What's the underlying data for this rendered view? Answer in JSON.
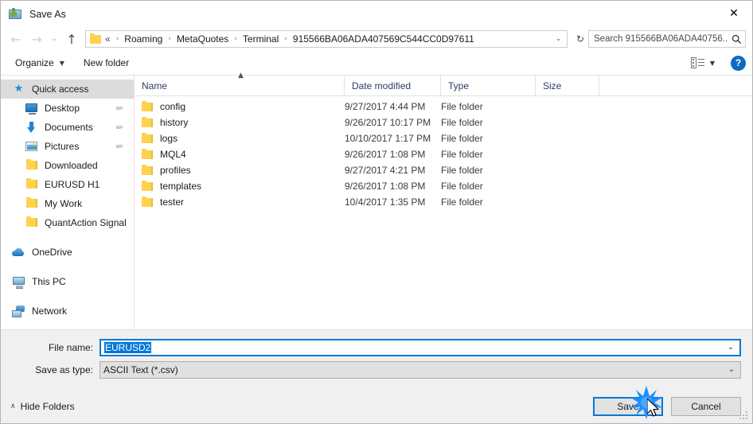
{
  "window": {
    "title": "Save As",
    "icon": "save-as-icon",
    "close_label": "✕"
  },
  "address_bar": {
    "back_icon": "←",
    "forward_icon": "→",
    "recent_icon": "⌄",
    "up_icon": "↑",
    "folder_icon": "folder-icon",
    "lead": "«",
    "crumbs": [
      "Roaming",
      "MetaQuotes",
      "Terminal",
      "915566BA06ADA407569C544CC0D97611"
    ],
    "separator": "›",
    "dropdown_icon": "⌄",
    "refresh_icon": "↻"
  },
  "search": {
    "placeholder": "Search 915566BA06ADA40756...",
    "icon": "⚲"
  },
  "toolbar": {
    "organize_label": "Organize",
    "organize_caret": "▼",
    "new_folder_label": "New folder",
    "view_icon": "view-options-icon",
    "view_caret": "▼",
    "help_label": "?"
  },
  "sidebar": {
    "groups": [
      {
        "header": {
          "label": "Quick access",
          "icon": "star-icon",
          "selected": true
        },
        "items": [
          {
            "label": "Desktop",
            "icon": "desktop-icon",
            "pinned": true
          },
          {
            "label": "Documents",
            "icon": "documents-icon",
            "pinned": true
          },
          {
            "label": "Pictures",
            "icon": "pictures-icon",
            "pinned": true
          },
          {
            "label": "Downloaded",
            "icon": "folder-icon",
            "pinned": false
          },
          {
            "label": "EURUSD H1",
            "icon": "folder-icon",
            "pinned": false
          },
          {
            "label": "My Work",
            "icon": "folder-icon",
            "pinned": false
          },
          {
            "label": "QuantAction Signal",
            "icon": "folder-icon",
            "pinned": false
          }
        ]
      }
    ],
    "roots": [
      {
        "label": "OneDrive",
        "icon": "onedrive-icon"
      },
      {
        "label": "This PC",
        "icon": "this-pc-icon"
      },
      {
        "label": "Network",
        "icon": "network-icon"
      }
    ],
    "pin_icon": "✐"
  },
  "file_list": {
    "columns": [
      {
        "label": "Name",
        "sorted": "asc"
      },
      {
        "label": "Date modified",
        "sorted": ""
      },
      {
        "label": "Type",
        "sorted": ""
      },
      {
        "label": "Size",
        "sorted": ""
      }
    ],
    "sort_caret": "▲",
    "rows": [
      {
        "name": "config",
        "date": "9/27/2017 4:44 PM",
        "type": "File folder",
        "size": ""
      },
      {
        "name": "history",
        "date": "9/26/2017 10:17 PM",
        "type": "File folder",
        "size": ""
      },
      {
        "name": "logs",
        "date": "10/10/2017 1:17 PM",
        "type": "File folder",
        "size": ""
      },
      {
        "name": "MQL4",
        "date": "9/26/2017 1:08 PM",
        "type": "File folder",
        "size": ""
      },
      {
        "name": "profiles",
        "date": "9/27/2017 4:21 PM",
        "type": "File folder",
        "size": ""
      },
      {
        "name": "templates",
        "date": "9/26/2017 1:08 PM",
        "type": "File folder",
        "size": ""
      },
      {
        "name": "tester",
        "date": "10/4/2017 1:35 PM",
        "type": "File folder",
        "size": ""
      }
    ]
  },
  "form": {
    "file_name_label": "File name:",
    "file_name_value": "EURUSD2",
    "file_name_selected": true,
    "save_as_type_label": "Save as type:",
    "save_as_type_value": "ASCII Text (*.csv)",
    "chevron": "⌄"
  },
  "footer": {
    "hide_folders_label": "Hide Folders",
    "hide_folders_caret": "∧",
    "save_label": "Save",
    "cancel_label": "Cancel",
    "resize_grip": "resize-grip-icon"
  },
  "colors": {
    "accent": "#0078d7",
    "folder": "#ffd24d",
    "help_blue": "#0b6cbf",
    "selection": "#0078d7",
    "sidebar_selected": "#dcdcdc",
    "form_bg": "#f0f0f0"
  }
}
